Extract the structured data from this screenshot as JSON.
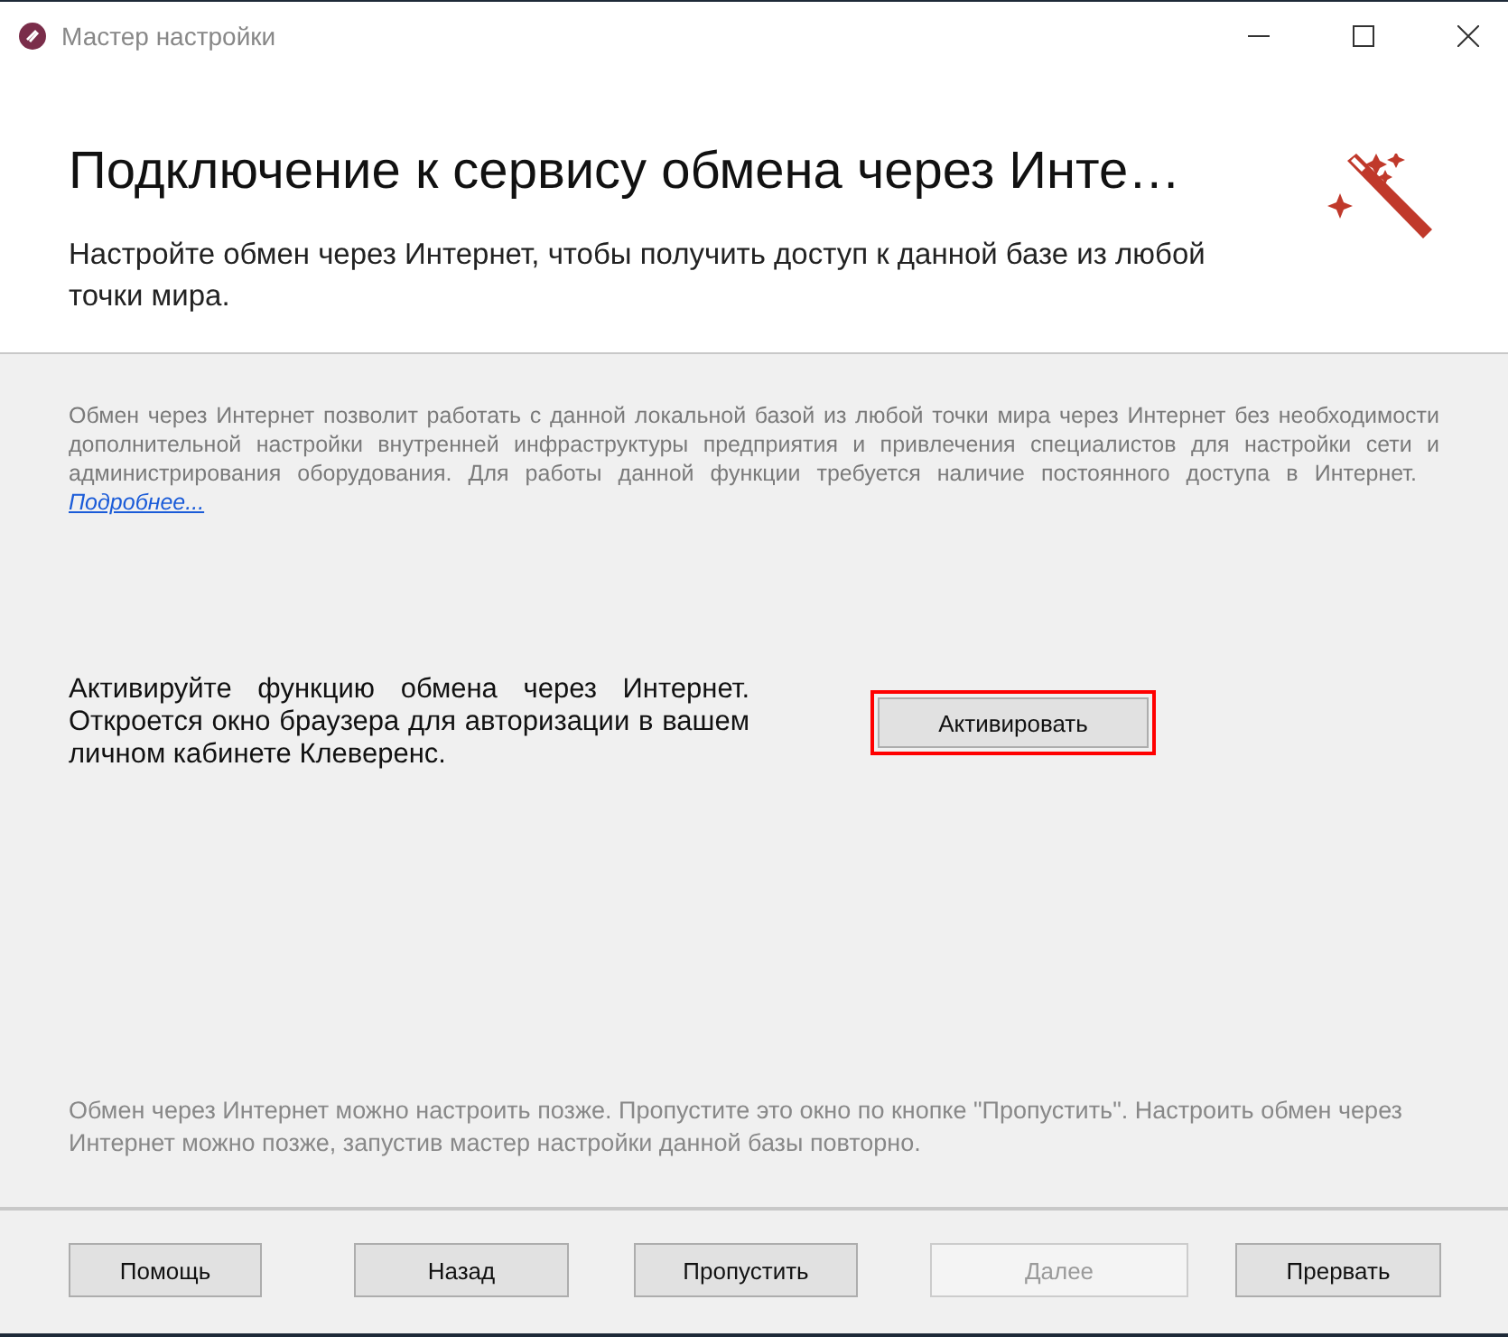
{
  "window": {
    "title": "Мастер настройки"
  },
  "header": {
    "title": "Подключение к сервису обмена через Инте…",
    "subtitle": "Настройте обмен через Интернет, чтобы получить доступ к данной базе из любой точки мира."
  },
  "info": {
    "text": "Обмен через Интернет позволит работать с данной локальной базой из любой точки мира через Интернет без необходимости дополнительной настройки внутренней инфраструктуры предприятия и привлечения специалистов для настройки сети и администрирования оборудования. Для работы данной функции требуется наличие постоянного доступа в Интернет.",
    "link": "Подробнее..."
  },
  "activate": {
    "text": "Активируйте функцию обмена через Интернет. Откроется окно браузера для авторизации в вашем личном кабинете Клеверенс.",
    "button": "Активировать",
    "highlighted": true
  },
  "note": "Обмен через Интернет можно настроить позже. Пропустите это окно по кнопке \"Пропустить\". Настроить обмен через Интернет можно позже, запустив мастер настройки данной базы повторно.",
  "buttons": [
    {
      "label": "Помощь",
      "disabled": false
    },
    {
      "label": "Назад",
      "disabled": false
    },
    {
      "label": "Пропустить",
      "disabled": false
    },
    {
      "label": "Далее",
      "disabled": true
    },
    {
      "label": "Прервать",
      "disabled": false
    }
  ]
}
